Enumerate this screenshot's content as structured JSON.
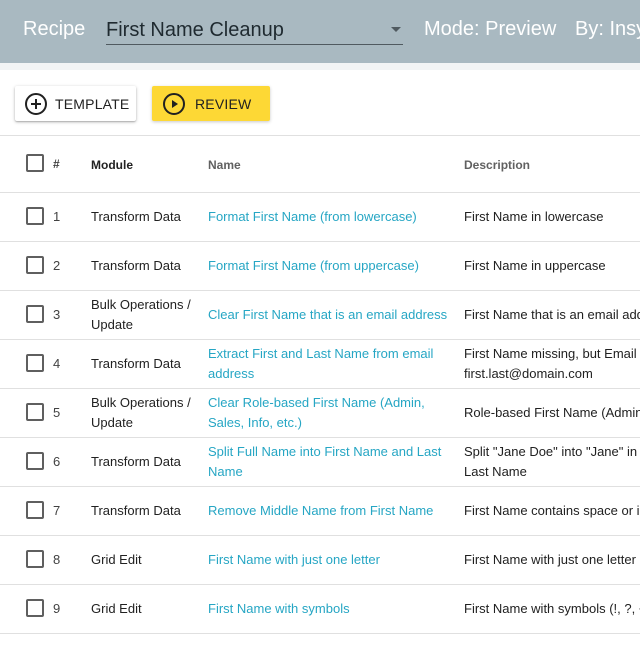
{
  "header": {
    "recipe_label": "Recipe",
    "recipe_value": "First Name Cleanup",
    "mode_label": "Mode: Preview",
    "by_label": "By: Insy"
  },
  "toolbar": {
    "template_label": "TEMPLATE",
    "review_label": "REVIEW",
    "review_color": "#fdd835"
  },
  "table": {
    "columns": {
      "num": "#",
      "module": "Module",
      "name": "Name",
      "description": "Description"
    },
    "link_color": "#26a6c4",
    "rows": [
      {
        "num": "1",
        "module": "Transform Data",
        "name": "Format First Name (from lowercase)",
        "description": "First Name in lowercase"
      },
      {
        "num": "2",
        "module": "Transform Data",
        "name": "Format First Name (from uppercase)",
        "description": "First Name in uppercase"
      },
      {
        "num": "3",
        "module": "Bulk Operations / Update",
        "name": "Clear First Name that is an email address",
        "description": "First Name that is an email add"
      },
      {
        "num": "4",
        "module": "Transform Data",
        "name": "Extract First and Last Name from email address",
        "description": "First Name missing, but Email t",
        "description_2": "first.last@domain.com"
      },
      {
        "num": "5",
        "module": "Bulk Operations / Update",
        "name": "Clear Role-based First Name (Admin, Sales, Info, etc.)",
        "description": "Role-based First Name (Admin"
      },
      {
        "num": "6",
        "module": "Transform Data",
        "name": "Split Full Name into First Name and Last Name",
        "description": "Split \"Jane Doe\" into \"Jane\" in F",
        "description_2": "Last Name"
      },
      {
        "num": "7",
        "module": "Transform Data",
        "name": "Remove Middle Name from First Name",
        "description": "First Name contains space or i"
      },
      {
        "num": "8",
        "module": "Grid Edit",
        "name": "First Name with just one letter",
        "description": "First Name with just one letter"
      },
      {
        "num": "9",
        "module": "Grid Edit",
        "name": "First Name with symbols",
        "description": "First Name with symbols (!, ?, +"
      }
    ]
  }
}
